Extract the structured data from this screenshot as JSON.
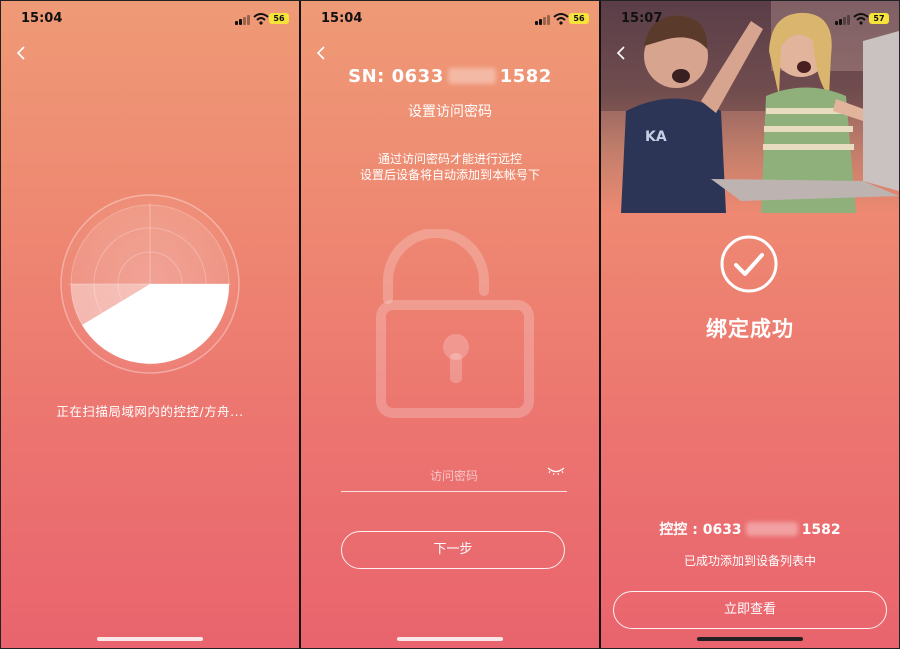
{
  "screen1": {
    "status": {
      "time": "15:04",
      "battery": "56"
    },
    "scan_text": "正在扫描局域网内的控控/方舟..."
  },
  "screen2": {
    "status": {
      "time": "15:04",
      "battery": "56"
    },
    "sn_prefix": "SN: 0633",
    "sn_suffix": "1582",
    "title": "设置访问密码",
    "desc_line1": "通过访问密码才能进行远控",
    "desc_line2": "设置后设备将自动添加到本帐号下",
    "password_placeholder": "访问密码",
    "next_button": "下一步"
  },
  "screen3": {
    "status": {
      "time": "15:07",
      "battery": "57"
    },
    "success_title": "绑定成功",
    "device_prefix": "控控 : 0633",
    "device_suffix": "1582",
    "added_text": "已成功添加到设备列表中",
    "view_button": "立即查看"
  },
  "colors": {
    "gradient_top": "#ef9a76",
    "gradient_bottom": "#e9646e",
    "battery": "#f5e23a"
  }
}
